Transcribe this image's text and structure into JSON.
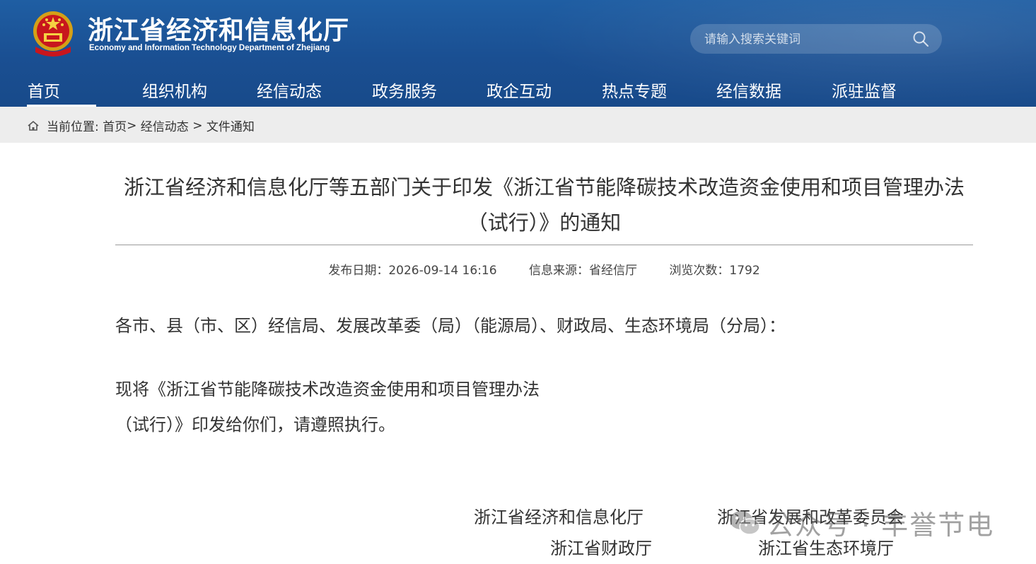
{
  "header": {
    "title": "浙江省经济和信息化厅",
    "subtitle": "Economy and Information Technology Department of Zhejiang",
    "search_placeholder": "请输入搜索关键词"
  },
  "nav": [
    {
      "label": "首页"
    },
    {
      "label": "组织机构"
    },
    {
      "label": "经信动态"
    },
    {
      "label": "政务服务"
    },
    {
      "label": "政企互动"
    },
    {
      "label": "热点专题"
    },
    {
      "label": "经信数据"
    },
    {
      "label": "派驻监督"
    }
  ],
  "breadcrumb": {
    "prefix": "当前位置:",
    "items": [
      "首页",
      "经信动态",
      "文件通知"
    ],
    "sep1": ">",
    "sep2": " > "
  },
  "article": {
    "title": "浙江省经济和信息化厅等五部门关于印发《浙江省节能降碳技术改造资金使用和项目管理办法（试行）》的通知",
    "date": "发布日期：2026-09-14 16:16",
    "source": "信息来源：省经信厅",
    "views": "浏览次数：1792",
    "addressee": "各市、县（市、区）经信局、发展改革委（局）（能源局）、财政局、生态环境局（分局）：",
    "body_line1": "现将《浙江省节能降碳技术改造资金使用和项目管理办法",
    "body_line2": "（试行）》印发给你们，请遵照执行。",
    "signatures": [
      "浙江省经济和信息化厅",
      "浙江省发展和改革委员会",
      "浙江省财政厅",
      "浙江省生态环境厅"
    ]
  },
  "watermark": {
    "text": "公众号 · 丰誉节电",
    "icon": "wechat-icon"
  },
  "colors": {
    "header_blue": "#1a4f92",
    "breadcrumb_bg": "#ededed"
  }
}
